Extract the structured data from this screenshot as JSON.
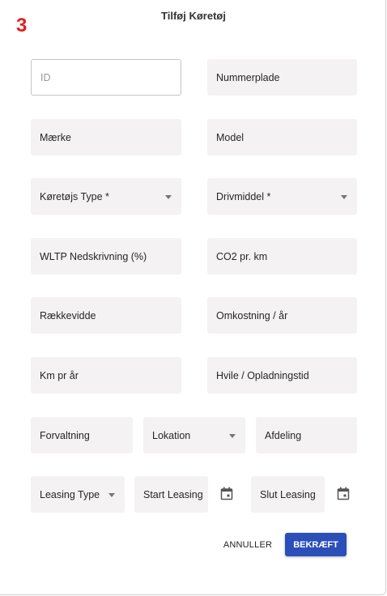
{
  "badge": "3",
  "title": "Tilføj Køretøj",
  "fields": {
    "id": "ID",
    "nummerplade": "Nummerplade",
    "maerke": "Mærke",
    "model": "Model",
    "koretojs_type": "Køretøjs Type *",
    "drivmiddel": "Drivmiddel *",
    "wltp": "WLTP Nedskrivning (%)",
    "co2": "CO2 pr. km",
    "raekkevidde": "Rækkevidde",
    "omkostning": "Omkostning / år",
    "km_pr_aar": "Km pr år",
    "hvile": "Hvile / Opladningstid",
    "forvaltning": "Forvaltning",
    "lokation": "Lokation",
    "afdeling": "Afdeling",
    "leasing_type": "Leasing Type",
    "start_leasing": "Start Leasing",
    "slut_leasing": "Slut Leasing"
  },
  "actions": {
    "cancel": "ANNULLER",
    "confirm": "BEKRÆFT"
  },
  "colors": {
    "badge": "#e02020",
    "confirm_bg": "#2b4fb8",
    "field_bg": "#f4f2f2"
  }
}
